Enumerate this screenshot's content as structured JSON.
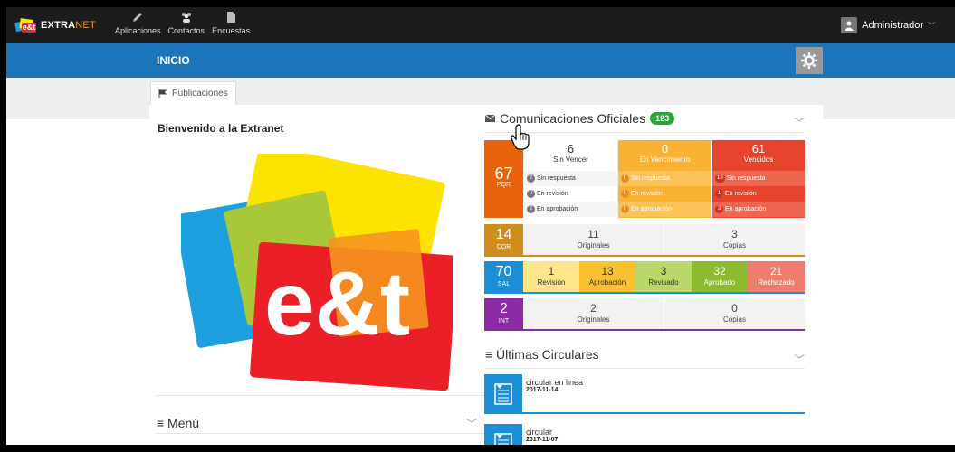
{
  "app": {
    "brand_prefix": "EXTRA",
    "brand_suffix": "NET",
    "logo_letters": "e&t"
  },
  "topnav": [
    {
      "label": "Aplicaciones",
      "icon": "pencil-icon"
    },
    {
      "label": "Contactos",
      "icon": "users-icon"
    },
    {
      "label": "Encuestas",
      "icon": "document-icon"
    }
  ],
  "user": {
    "name": "Administrador",
    "chevron": "﹀"
  },
  "page": {
    "title": "INICIO"
  },
  "tabs": [
    {
      "label": "Publicaciones",
      "icon": "flag-icon"
    }
  ],
  "welcome": {
    "title": "Bienvenido a la Extranet",
    "art_letters": "e&t"
  },
  "menu": {
    "title": "≡ Menú",
    "chevron": "﹀"
  },
  "comunicaciones": {
    "title": "Comunicaciones Oficiales",
    "badge": "123",
    "chevron": "﹀",
    "pqr": {
      "total": "67",
      "code": "PQR",
      "columns": [
        {
          "count": "6",
          "label": "Sin Vencer",
          "bg": "#ffffff",
          "fg": "#333333",
          "pill_bg": "#777777",
          "stats": [
            {
              "n": "2",
              "label": "Sin respuesta"
            },
            {
              "n": "0",
              "label": "En revisión"
            },
            {
              "n": "2",
              "label": "En aprobación"
            }
          ]
        },
        {
          "count": "0",
          "label": "En Vencimiento",
          "bg": "#f9b233",
          "fg": "#ffffff",
          "pill_bg": "#e0932a",
          "stats": [
            {
              "n": "0",
              "label": "Sin respuesta"
            },
            {
              "n": "0",
              "label": "En revisión"
            },
            {
              "n": "0",
              "label": "En aprobación"
            }
          ]
        },
        {
          "count": "61",
          "label": "Vencidos",
          "bg": "#e8432d",
          "fg": "#ffffff",
          "pill_bg": "#c93322",
          "stats": [
            {
              "n": "19",
              "label": "Sin respuesta"
            },
            {
              "n": "1",
              "label": "En revisión"
            },
            {
              "n": "3",
              "label": "En aprobación"
            }
          ]
        }
      ]
    },
    "cor": {
      "total": "14",
      "code": "COR",
      "color": "#ce8d1d",
      "cells": [
        {
          "n": "11",
          "label": "Originales"
        },
        {
          "n": "3",
          "label": "Copias"
        }
      ]
    },
    "sal": {
      "total": "70",
      "code": "SAL",
      "color": "#1b8ed6",
      "cells": [
        {
          "n": "1",
          "label": "Revisión",
          "bg": "#fde58a",
          "fg": "#333333"
        },
        {
          "n": "13",
          "label": "Aprobación",
          "bg": "#f9c032",
          "fg": "#333333"
        },
        {
          "n": "3",
          "label": "Revisado",
          "bg": "#b9d869",
          "fg": "#333333"
        },
        {
          "n": "32",
          "label": "Aprobado",
          "bg": "#8dbb2f",
          "fg": "#ffffff"
        },
        {
          "n": "21",
          "label": "Rechazado",
          "bg": "#f07d6b",
          "fg": "#ffffff"
        }
      ]
    },
    "int": {
      "total": "2",
      "code": "INT",
      "color": "#8b2ca6",
      "cells": [
        {
          "n": "2",
          "label": "Originales"
        },
        {
          "n": "0",
          "label": "Copias"
        }
      ]
    }
  },
  "circulares": {
    "title": "≡ Últimas Circulares",
    "chevron": "﹀",
    "items": [
      {
        "name": "circular en linea",
        "date": "2017-11-14"
      },
      {
        "name": "circular",
        "date": "2017-11-07"
      }
    ]
  },
  "colors": {
    "topbar": "#1c1c1c",
    "bluebar": "#1b75b8",
    "pqr_orange": "#e9630c"
  }
}
